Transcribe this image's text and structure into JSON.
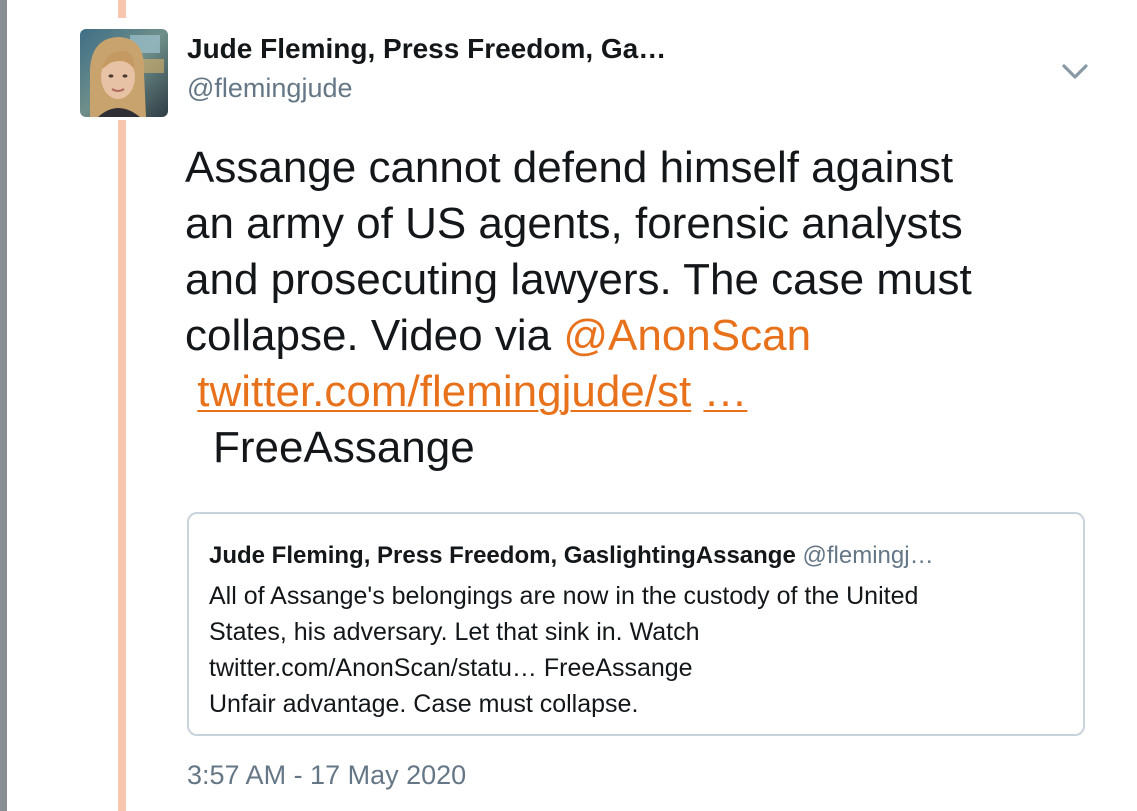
{
  "tweet": {
    "author": {
      "name": "Jude Fleming, Press Freedom, Ga…",
      "handle": "@flemingjude"
    },
    "menu_icon": "chevron-down-icon",
    "text": {
      "line1": "Assange cannot defend himself against",
      "line2": "an army of US agents, forensic analysts",
      "line3": "and prosecuting lawyers. The case must",
      "line4_prefix": "collapse. Video via ",
      "mention": "@AnonScan",
      "url": "twitter.com/flemingjude/st",
      "url_ellipsis": "…",
      "hashtag": "FreeAssange"
    },
    "quoted_tweet": {
      "author_name": "Jude Fleming, Press Freedom, GaslightingAssange",
      "author_handle": "@flemingj…",
      "line1": "All of Assange's belongings are now in the custody of the United",
      "line2": "States, his adversary. Let that sink in. Watch",
      "line3": "twitter.com/AnonScan/statu… FreeAssange",
      "line4": "Unfair advantage. Case must collapse."
    },
    "timestamp": "3:57 AM - 17 May 2020"
  },
  "colors": {
    "link": "#e8721c",
    "thread_line": "#f6c6ae",
    "secondary_text": "#657786",
    "primary_text": "#14171a",
    "card_border": "#c9d3dc"
  }
}
